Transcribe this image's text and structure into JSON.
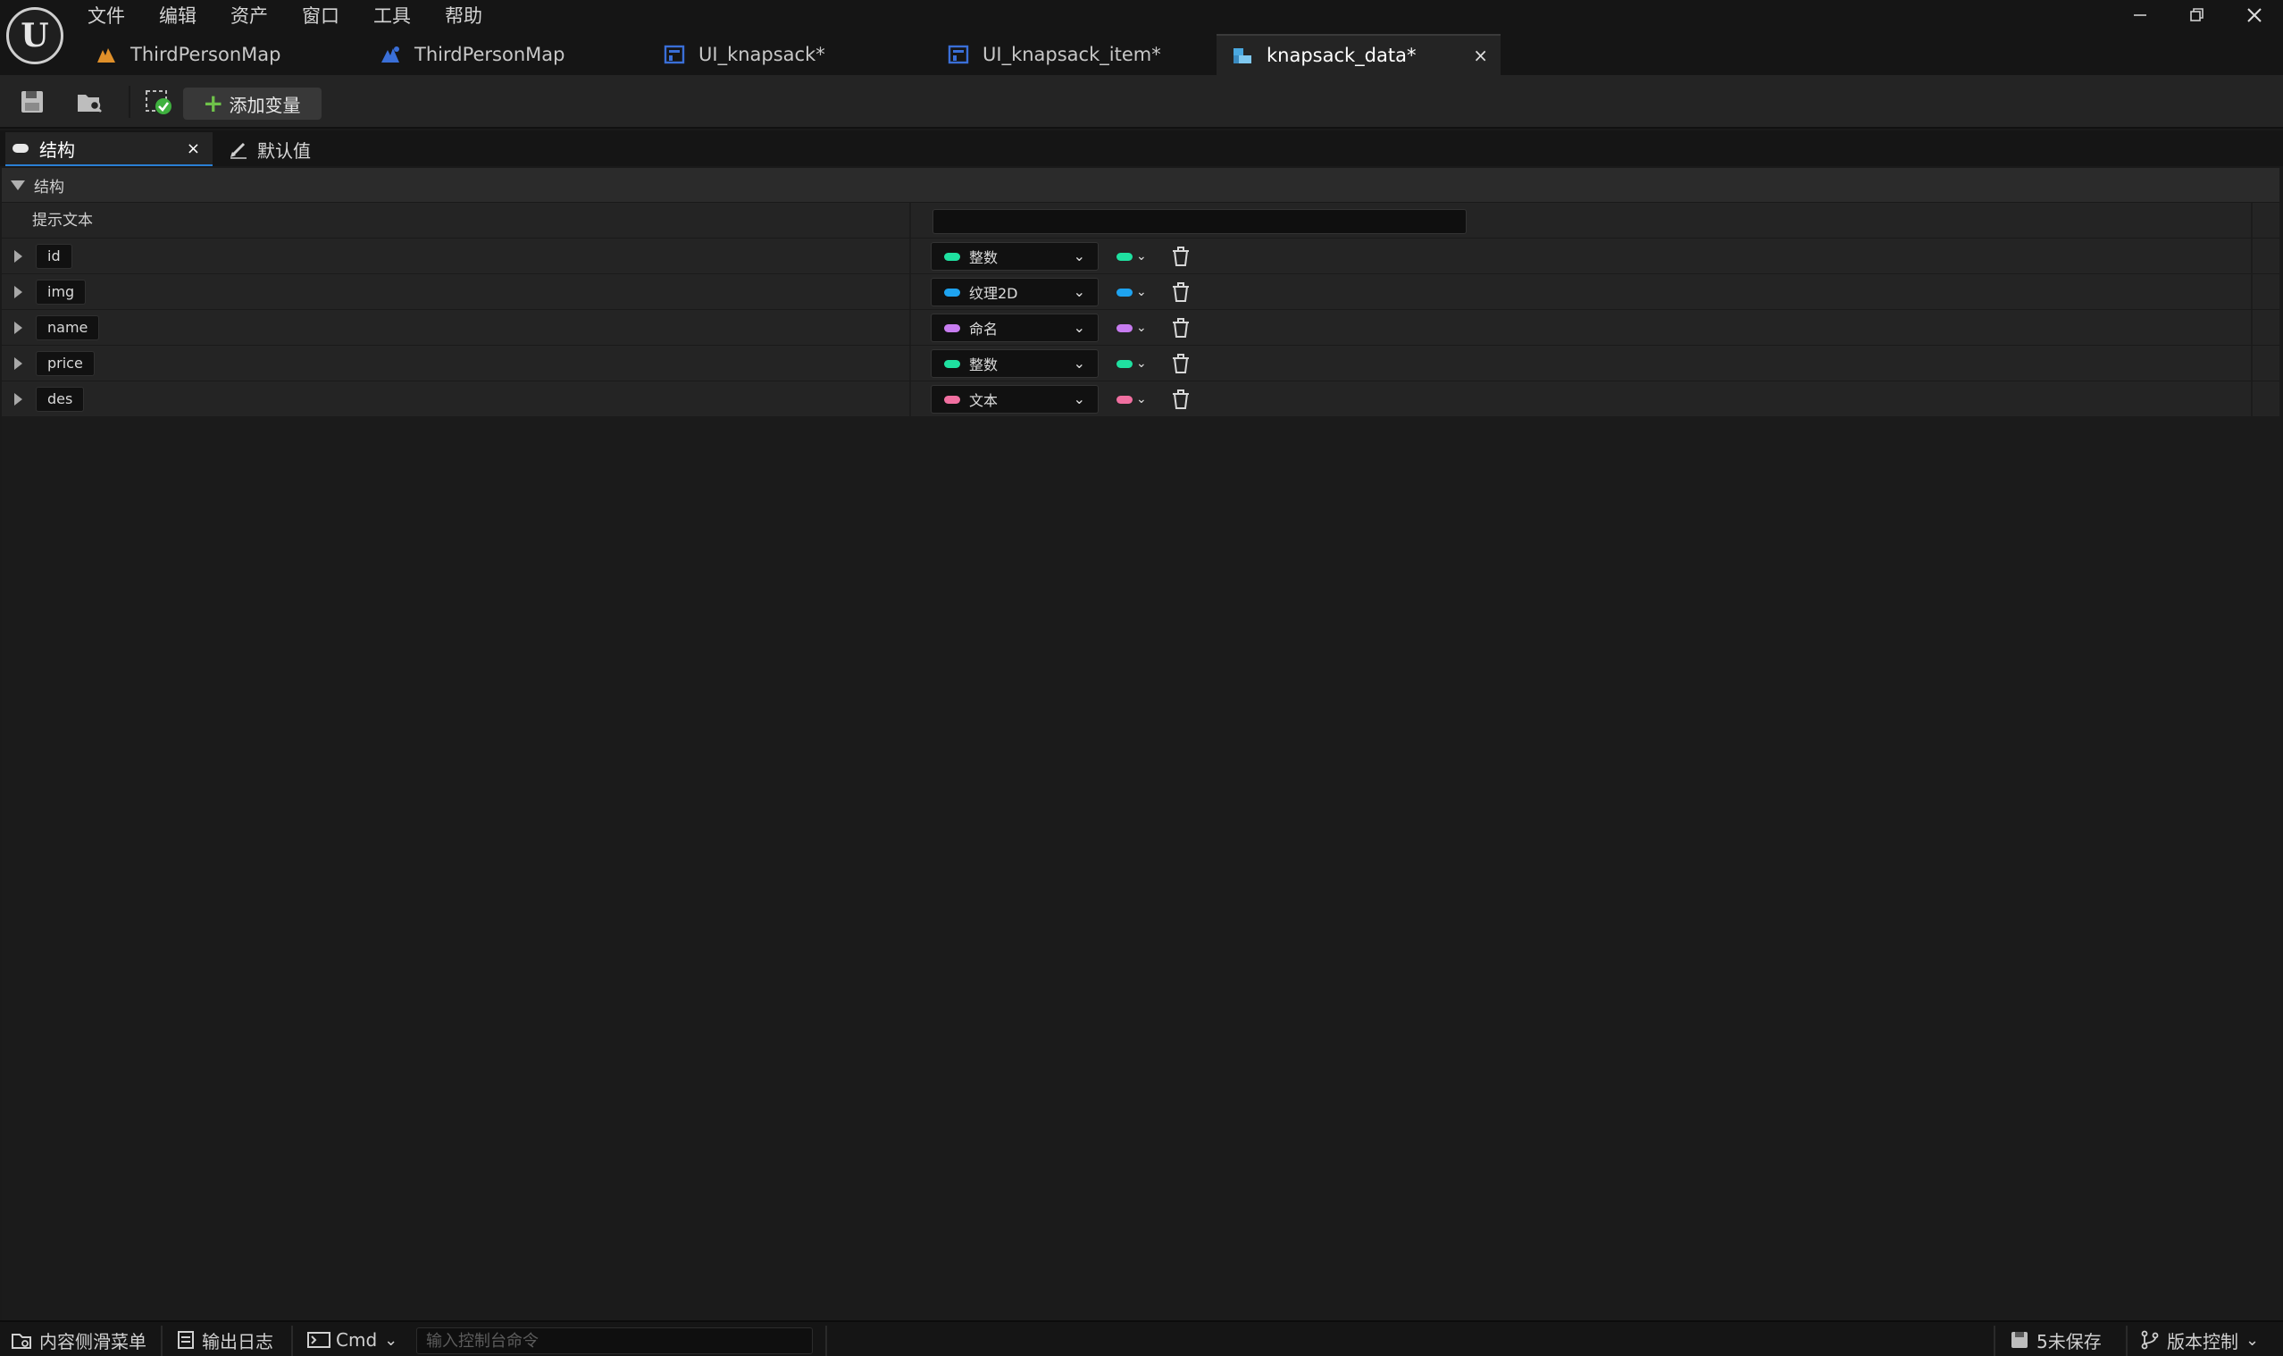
{
  "menu": [
    "文件",
    "编辑",
    "资产",
    "窗口",
    "工具",
    "帮助"
  ],
  "doc_tabs": [
    {
      "label": "ThirdPersonMap",
      "icon": "level-icon",
      "active": false
    },
    {
      "label": "ThirdPersonMap",
      "icon": "level-blueprint-icon",
      "active": false
    },
    {
      "label": "UI_knapsack*",
      "icon": "widget-blueprint-icon",
      "active": false
    },
    {
      "label": "UI_knapsack_item*",
      "icon": "widget-blueprint-icon",
      "active": false
    },
    {
      "label": "knapsack_data*",
      "icon": "struct-icon",
      "active": true,
      "close": "×"
    }
  ],
  "toolbar": {
    "add_variable_label": "添加变量"
  },
  "panel_tabs": {
    "structure": "结构",
    "structure_close": "×",
    "defaults": "默认值"
  },
  "details": {
    "category": "结构",
    "hint_label": "提示文本",
    "hint_value": "",
    "variables": [
      {
        "name": "id",
        "type": "整数",
        "color": "#1fe0a0"
      },
      {
        "name": "img",
        "type": "纹理2D",
        "color": "#1ea3f0"
      },
      {
        "name": "name",
        "type": "命名",
        "color": "#c77cf0"
      },
      {
        "name": "price",
        "type": "整数",
        "color": "#1fe0a0"
      },
      {
        "name": "des",
        "type": "文本",
        "color": "#f06fa0"
      }
    ]
  },
  "statusbar": {
    "content_drawer": "内容侧滑菜单",
    "output_log": "输出日志",
    "cmd": "Cmd",
    "cmd_placeholder": "输入控制台命令",
    "unsaved": "5未保存",
    "source_control": "版本控制"
  }
}
